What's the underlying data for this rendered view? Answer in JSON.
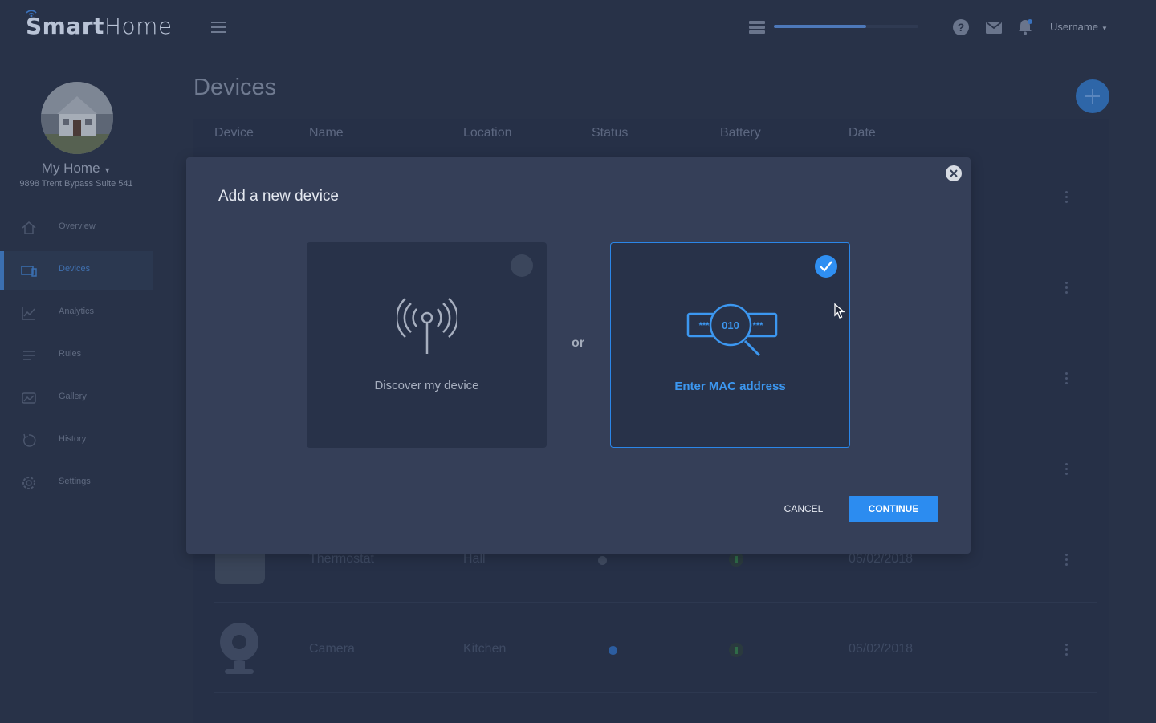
{
  "app": {
    "logo_bold": "Smart",
    "logo_thin": "Home",
    "progress": 0.64
  },
  "header": {
    "username": "Username"
  },
  "sidebar": {
    "home_name": "My Home",
    "home_address": "9898 Trent Bypass Suite 541",
    "items": [
      {
        "label": "Overview",
        "icon": "home-icon"
      },
      {
        "label": "Devices",
        "icon": "devices-icon",
        "active": true
      },
      {
        "label": "Analytics",
        "icon": "analytics-icon"
      },
      {
        "label": "Rules",
        "icon": "rules-icon"
      },
      {
        "label": "Gallery",
        "icon": "gallery-icon"
      },
      {
        "label": "History",
        "icon": "history-icon"
      },
      {
        "label": "Settings",
        "icon": "settings-icon"
      }
    ]
  },
  "page": {
    "title": "Devices",
    "columns": [
      "Device",
      "Name",
      "Location",
      "Status",
      "Battery",
      "Date"
    ],
    "rows": [
      {
        "name": "Thermostat",
        "location": "Hall",
        "date": "06/02/2018"
      },
      {
        "name": "Camera",
        "location": "Kitchen",
        "date": "06/02/2018"
      }
    ]
  },
  "modal": {
    "title": "Add a new device",
    "option_discover": "Discover my device",
    "separator": "or",
    "option_mac": "Enter MAC address",
    "mac_graphic_left": "***",
    "mac_graphic_center": "010",
    "mac_graphic_right": "***",
    "cancel_label": "CANCEL",
    "continue_label": "CONTINUE"
  },
  "colors": {
    "accent": "#2c8cf0",
    "modal_bg": "#353f58",
    "page_bg": "#283248"
  }
}
